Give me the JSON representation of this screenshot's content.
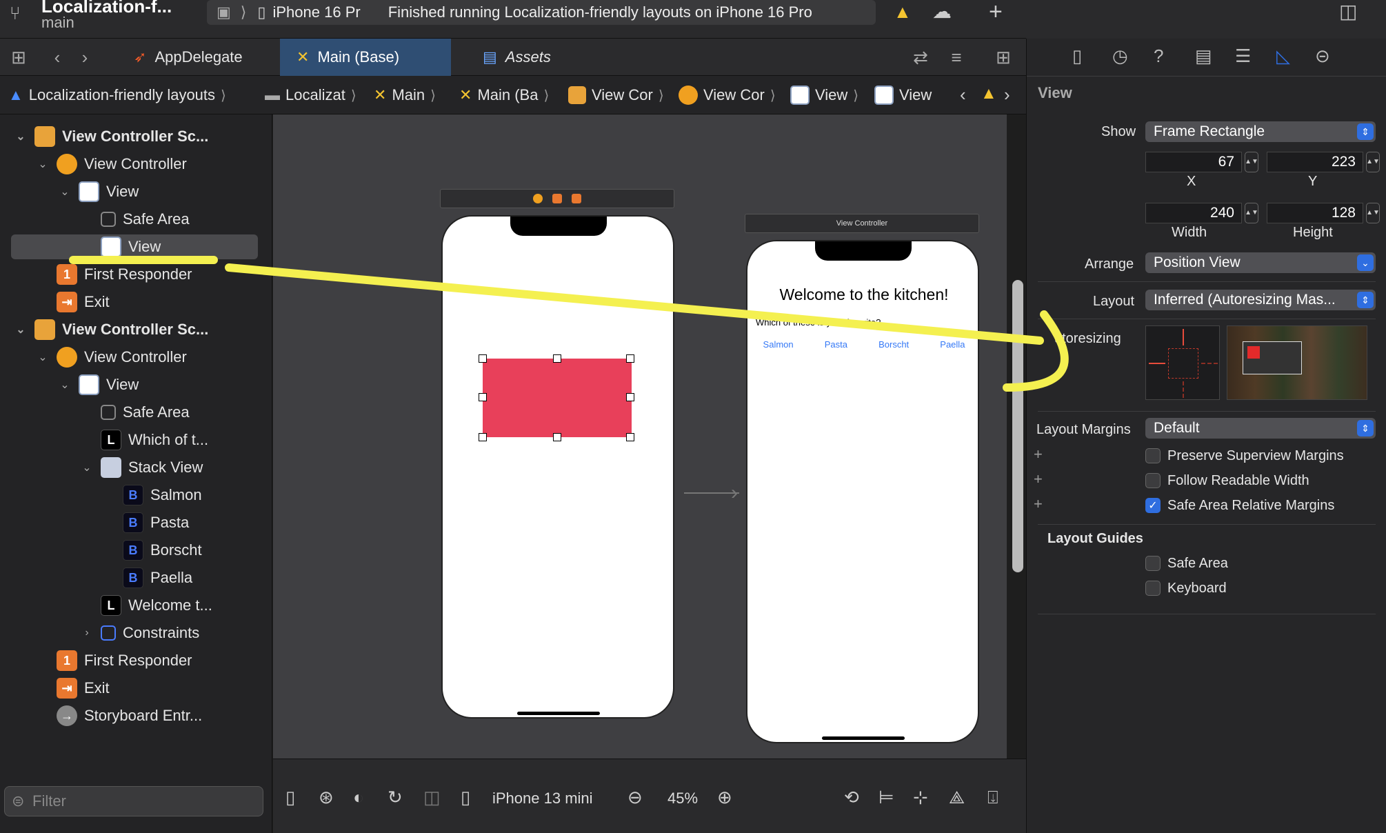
{
  "titlebar": {
    "project_name": "Localization-f...",
    "branch": "main",
    "device_short": "iPhone 16 Pr",
    "status": "Finished running Localization-friendly layouts on iPhone 16 Pro"
  },
  "tabs": [
    {
      "label": "AppDelegate",
      "active": false
    },
    {
      "label": "Main (Base)",
      "active": true
    },
    {
      "label": "Assets",
      "active": false
    }
  ],
  "jumpbar": [
    "Localization-friendly layouts",
    "Localizat",
    "Main",
    "Main (Ba",
    "View Cor",
    "View Cor",
    "View",
    "View"
  ],
  "navigator": {
    "scene1": {
      "scene": "View Controller Sc...",
      "vc": "View Controller",
      "view": "View",
      "safe_area": "Safe Area",
      "subview": "View",
      "first_responder": "First Responder",
      "exit": "Exit"
    },
    "scene2": {
      "scene": "View Controller Sc...",
      "vc": "View Controller",
      "view": "View",
      "safe_area": "Safe Area",
      "label1": "Which of t...",
      "stack": "Stack View",
      "buttons": [
        "Salmon",
        "Pasta",
        "Borscht",
        "Paella"
      ],
      "label2": "Welcome t...",
      "constraints": "Constraints",
      "first_responder": "First Responder",
      "exit": "Exit",
      "entry": "Storyboard Entr..."
    },
    "filter_placeholder": "Filter"
  },
  "canvas": {
    "scene2_title": "View Controller",
    "welcome": "Welcome to the kitchen!",
    "question": "Which of these is your favorite?",
    "buttons": [
      "Salmon",
      "Pasta",
      "Borscht",
      "Paella"
    ],
    "selected_color": "#e8405a"
  },
  "canvas_toolbar": {
    "device": "iPhone 13 mini",
    "zoom": "45%"
  },
  "inspector": {
    "section": "View",
    "show_label": "Show",
    "show_value": "Frame Rectangle",
    "x_value": "67",
    "x_label": "X",
    "y_value": "223",
    "y_label": "Y",
    "width_value": "240",
    "width_label": "Width",
    "height_value": "128",
    "height_label": "Height",
    "arrange_label": "Arrange",
    "arrange_value": "Position View",
    "layout_label": "Layout",
    "layout_value": "Inferred (Autoresizing Mas...",
    "autoresizing_label": "utoresizing",
    "margins_label": "Layout Margins",
    "margins_value": "Default",
    "preserve": "Preserve Superview Margins",
    "readable": "Follow Readable Width",
    "safe_margins": "Safe Area Relative Margins",
    "guides_title": "Layout Guides",
    "guide_safe": "Safe Area",
    "guide_keyboard": "Keyboard"
  },
  "colors": {
    "accent": "#2f6ee0",
    "annotation": "#f4f050"
  }
}
